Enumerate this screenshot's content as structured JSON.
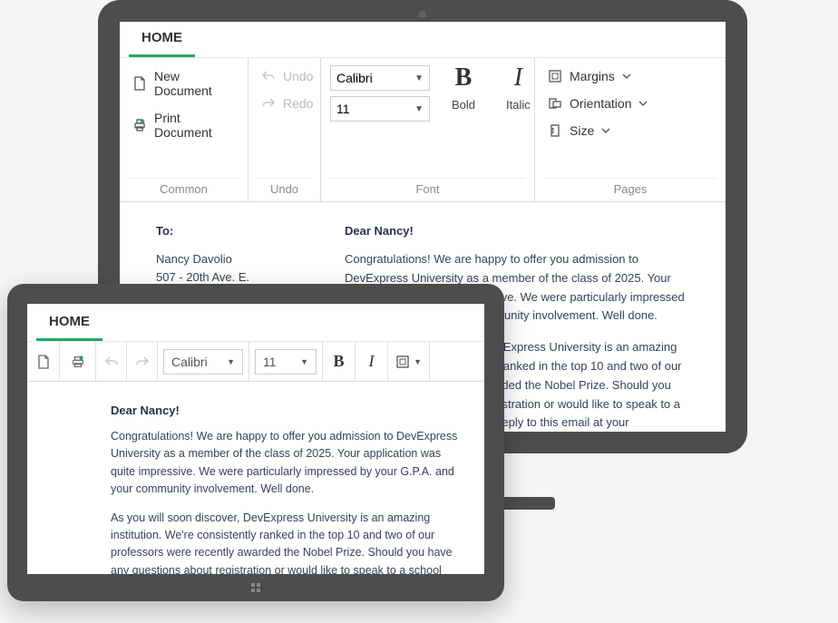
{
  "desktop": {
    "tab": "HOME",
    "groups": {
      "common": {
        "label": "Common",
        "new_doc": "New Document",
        "print_doc": "Print Document"
      },
      "undo": {
        "label": "Undo",
        "undo": "Undo",
        "redo": "Redo"
      },
      "font": {
        "label": "Font",
        "font_name": "Calibri",
        "font_size": "11",
        "bold_glyph": "B",
        "bold_label": "Bold",
        "italic_glyph": "I",
        "italic_label": "Italic"
      },
      "pages": {
        "label": "Pages",
        "margins": "Margins",
        "orientation": "Orientation",
        "size": "Size"
      }
    },
    "doc": {
      "to_label": "To:",
      "to_name": "Nancy Davolio",
      "to_addr": "507 - 20th Ave. E.",
      "greeting": "Dear Nancy!",
      "p1": "Congratulations! We are happy to offer you admission to DevExpress University as a member of the class of  2025. Your application was quite impressive.  We were particularly impressed by your G.P.A.  and your community  involvement. Well done.",
      "p2": "As you will soon discover, DevExpress University is an amazing institution.  We're consistently ranked in the top 10 and two of our professors were recently awarded the Nobel Prize. Should you have any questions about registration or would like to speak to a school counselor, feel free to reply to this email at your convenience."
    }
  },
  "tablet": {
    "tab": "HOME",
    "ribbon": {
      "font_name": "Calibri",
      "font_size": "11"
    },
    "doc": {
      "greeting": "Dear Nancy!",
      "p1": "Congratulations! We are happy to offer you admission to DevExpress University as a member of the class of  2025. Your application was quite impressive.  We were particularly impressed by your G.P.A.  and your community  involvement. Well done.",
      "p2": "As you will soon discover, DevExpress University is an amazing institution.  We're consistently ranked in the top 10 and two of our professors were recently awarded the Nobel Prize. Should you have any questions about registration or would like to speak to a school counselor, feel free to reply to this email at your convenience."
    }
  }
}
